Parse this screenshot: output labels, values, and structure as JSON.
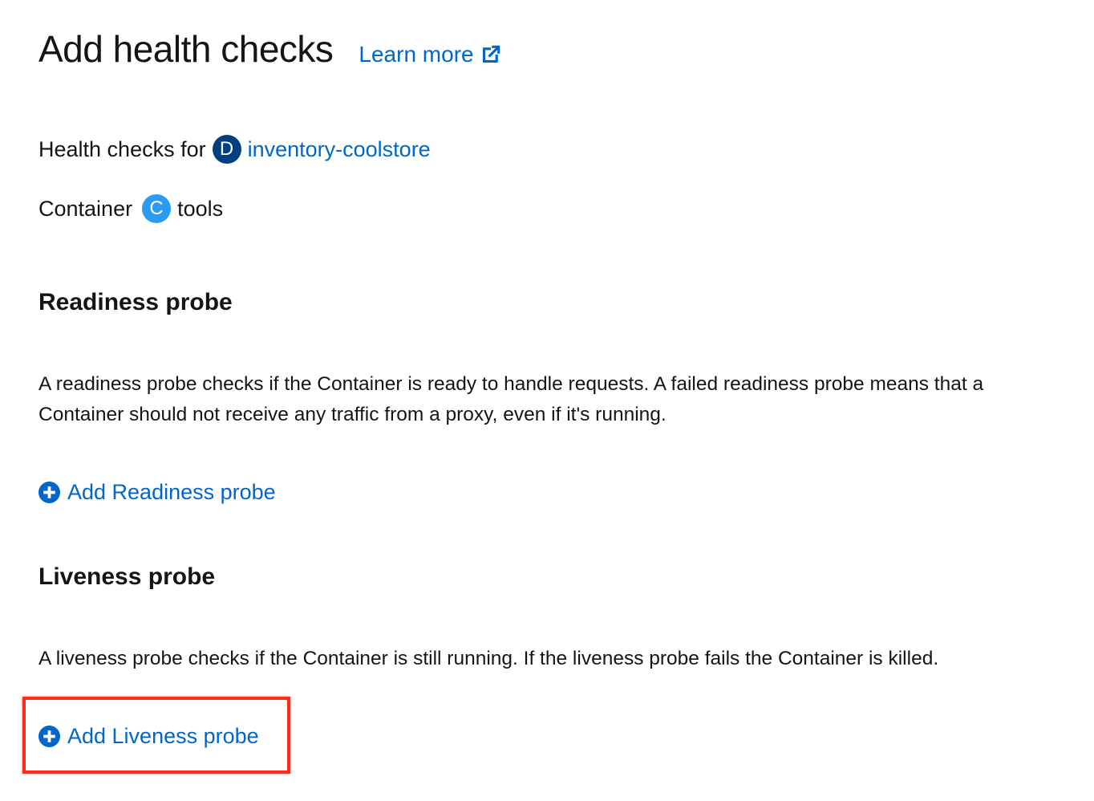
{
  "header": {
    "title": "Add health checks",
    "learn_more_label": "Learn more"
  },
  "meta": {
    "health_checks_for_label": "Health checks for",
    "deployment_badge": "D",
    "deployment_name": "inventory-coolstore",
    "container_label": "Container",
    "container_badge": "C",
    "container_name": "tools"
  },
  "readiness": {
    "title": "Readiness probe",
    "description": "A readiness probe checks if the Container is ready to handle requests. A failed readiness probe means that a Container should not receive any traffic from a proxy, even if it's running.",
    "add_label": "Add Readiness probe"
  },
  "liveness": {
    "title": "Liveness probe",
    "description": "A liveness probe checks if the Container is still running. If the liveness probe fails the Container is killed.",
    "add_label": "Add Liveness probe"
  },
  "colors": {
    "link": "#0066cc",
    "deployment_badge": "#004080",
    "container_badge": "#2b9af3",
    "highlight": "#ff2a1a"
  },
  "icons": {
    "learn_more": "external-link-icon",
    "add": "plus-circle-icon"
  }
}
